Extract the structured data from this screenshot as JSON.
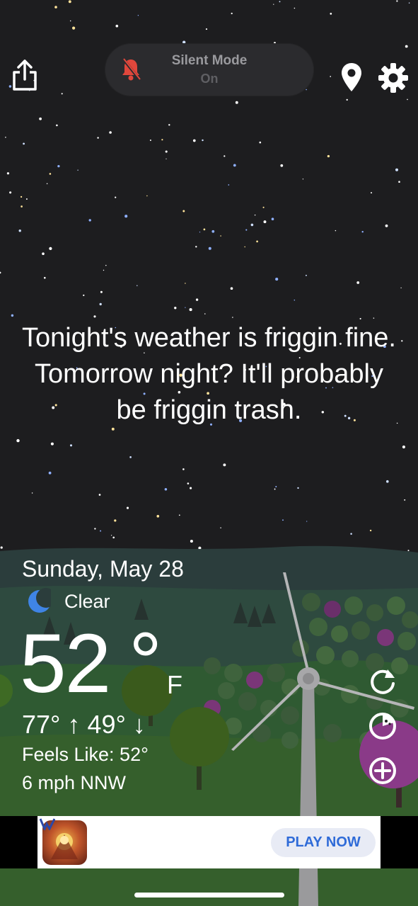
{
  "status": {
    "silent_mode_label": "Silent Mode",
    "silent_mode_state": "On"
  },
  "message": "Tonight's weather is friggin fine. Tomorrow night? It'll probably be friggin trash.",
  "weather": {
    "date": "Sunday, May 28",
    "condition": "Clear",
    "condition_icon": "moon-icon",
    "temperature": "52",
    "degree": "°",
    "unit": "F",
    "high_low": "77° ↑  49° ↓",
    "feels_like": "Feels Like: 52°",
    "wind": "6 mph NNW"
  },
  "ad": {
    "cta": "PLAY NOW"
  },
  "icons": [
    "share-icon",
    "bell-slash-icon",
    "location-pin-icon",
    "gear-icon",
    "refresh-icon",
    "radar-icon",
    "add-icon"
  ],
  "colors": {
    "sky": "#1d1d1f",
    "muted_bell": "#e0473c",
    "cta": "#2f6bd8"
  }
}
